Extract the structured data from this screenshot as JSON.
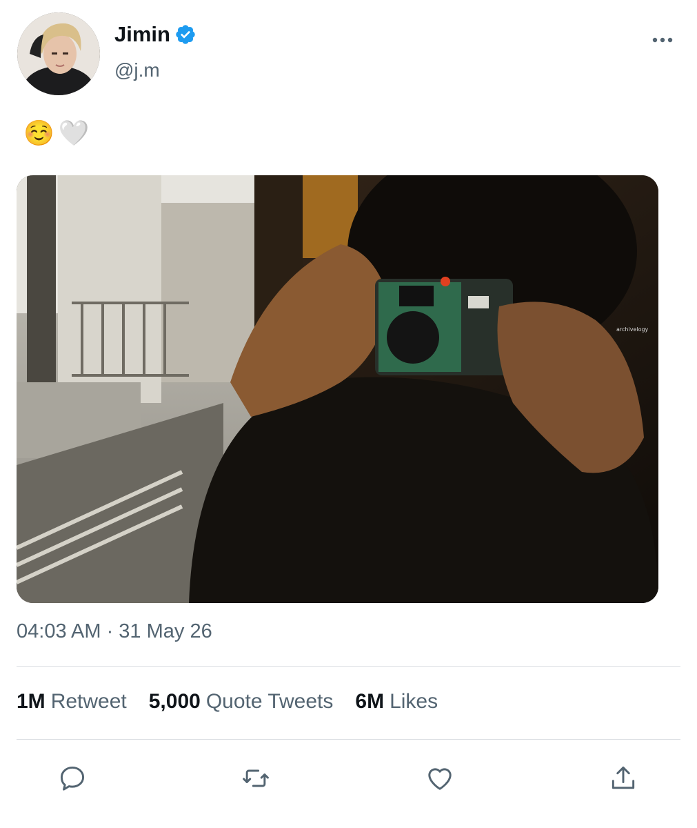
{
  "author": {
    "name": "Jimin",
    "handle": "@j.m",
    "verified": true,
    "avatar_icon": "profile-photo"
  },
  "tweet": {
    "text_emoji_1": "☺️",
    "text_emoji_2": "🤍",
    "media_description": "photo",
    "watermark": "archivelogy",
    "timestamp": "04:03 AM · 31 May 26"
  },
  "stats": {
    "retweets_count": "1M",
    "retweets_label": "Retweet",
    "quotes_count": "5,000",
    "quotes_label": "Quote Tweets",
    "likes_count": "6M",
    "likes_label": "Likes"
  },
  "actions": [
    "reply-icon",
    "retweet-icon",
    "like-icon",
    "share-icon"
  ],
  "colors": {
    "verified": "#1d9bf0",
    "secondary_text": "#536471",
    "icon": "#536471",
    "divider": "#d9dde1"
  }
}
